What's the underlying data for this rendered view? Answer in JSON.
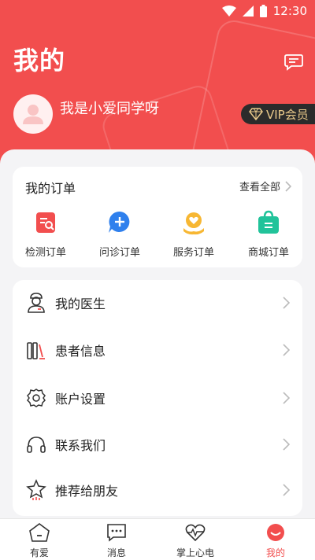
{
  "status_bar": {
    "time": "12:30"
  },
  "header": {
    "title": "我的",
    "username": "我是小爱同学呀",
    "vip_label": "VIP会员"
  },
  "orders": {
    "title": "我的订单",
    "view_all": "查看全部",
    "items": [
      {
        "label": "检测订单",
        "icon": "test-order-icon"
      },
      {
        "label": "问诊订单",
        "icon": "consult-order-icon"
      },
      {
        "label": "服务订单",
        "icon": "service-order-icon"
      },
      {
        "label": "商城订单",
        "icon": "mall-order-icon"
      }
    ]
  },
  "menu": [
    {
      "label": "我的医生",
      "icon": "doctor-icon"
    },
    {
      "label": "患者信息",
      "icon": "patient-info-icon"
    },
    {
      "label": "账户设置",
      "icon": "settings-gear-icon"
    },
    {
      "label": "联系我们",
      "icon": "headset-icon"
    },
    {
      "label": "推荐给朋友",
      "icon": "star-icon"
    }
  ],
  "tabbar": [
    {
      "label": "有爱",
      "icon": "home-face-icon"
    },
    {
      "label": "消息",
      "icon": "message-icon"
    },
    {
      "label": "掌上心电",
      "icon": "ecg-heart-icon"
    },
    {
      "label": "我的",
      "icon": "profile-icon",
      "active": true
    }
  ],
  "colors": {
    "accent": "#f24e4e",
    "vip_gold": "#e8c98a",
    "vip_bg": "#2b2b2b"
  }
}
